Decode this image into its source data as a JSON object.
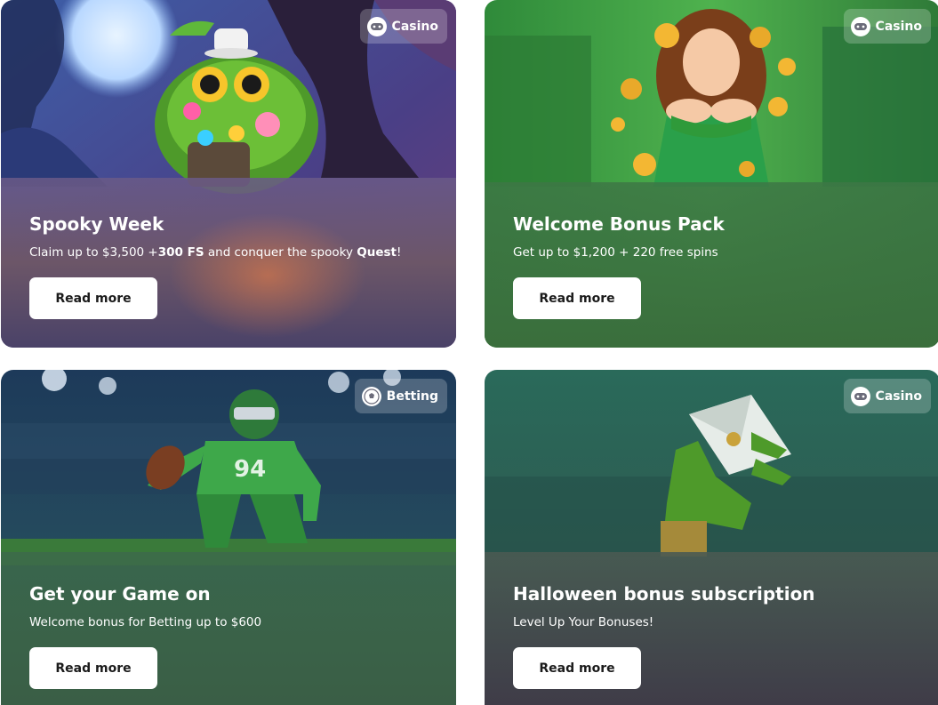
{
  "cards": [
    {
      "badge": "Casino",
      "badge_icon": "gamepad-icon",
      "title": "Spooky Week",
      "desc_parts": [
        "Claim up to $3,500 +",
        "300 FS",
        " and conquer the spooky ",
        "Quest",
        "!"
      ],
      "button": "Read more"
    },
    {
      "badge": "Casino",
      "badge_icon": "gamepad-icon",
      "title": "Welcome Bonus Pack",
      "description": "Get up to $1,200 + 220 free spins",
      "button": "Read more"
    },
    {
      "badge": "Betting",
      "badge_icon": "soccer-ball-icon",
      "title": "Get your Game on",
      "description": "Welcome bonus for Betting up to $600",
      "button": "Read more"
    },
    {
      "badge": "Casino",
      "badge_icon": "gamepad-icon",
      "title": "Halloween bonus subscription",
      "description": "Level Up Your Bonuses!",
      "button": "Read more"
    }
  ],
  "colors": {
    "card1_bg": "#5b4d7a",
    "card2_bg": "#3f7a45",
    "card3_bg": "#3b6147",
    "card4_bg": "#44434d",
    "button_bg": "#ffffff",
    "text": "#ffffff"
  }
}
